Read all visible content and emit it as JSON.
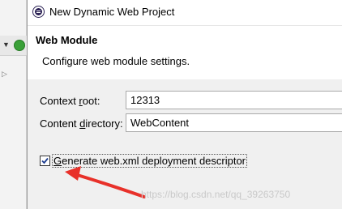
{
  "window": {
    "title": "New Dynamic Web Project"
  },
  "header": {
    "title": "Web Module",
    "description": "Configure web module settings."
  },
  "form": {
    "context_root": {
      "label_pre": "Context ",
      "label_accel": "r",
      "label_post": "oot:",
      "value": "12313"
    },
    "content_directory": {
      "label_pre": "Content ",
      "label_accel": "d",
      "label_post": "irectory:",
      "value": "WebContent"
    },
    "generate_web_xml": {
      "label_pre": "",
      "label_accel": "G",
      "label_post": "enerate web.xml deployment descriptor",
      "checked": true
    }
  },
  "watermark": "https://blog.csdn.net/qq_39263750",
  "colors": {
    "annotation_arrow": "#e8312a",
    "checkbox_check": "#1d3d8f"
  }
}
